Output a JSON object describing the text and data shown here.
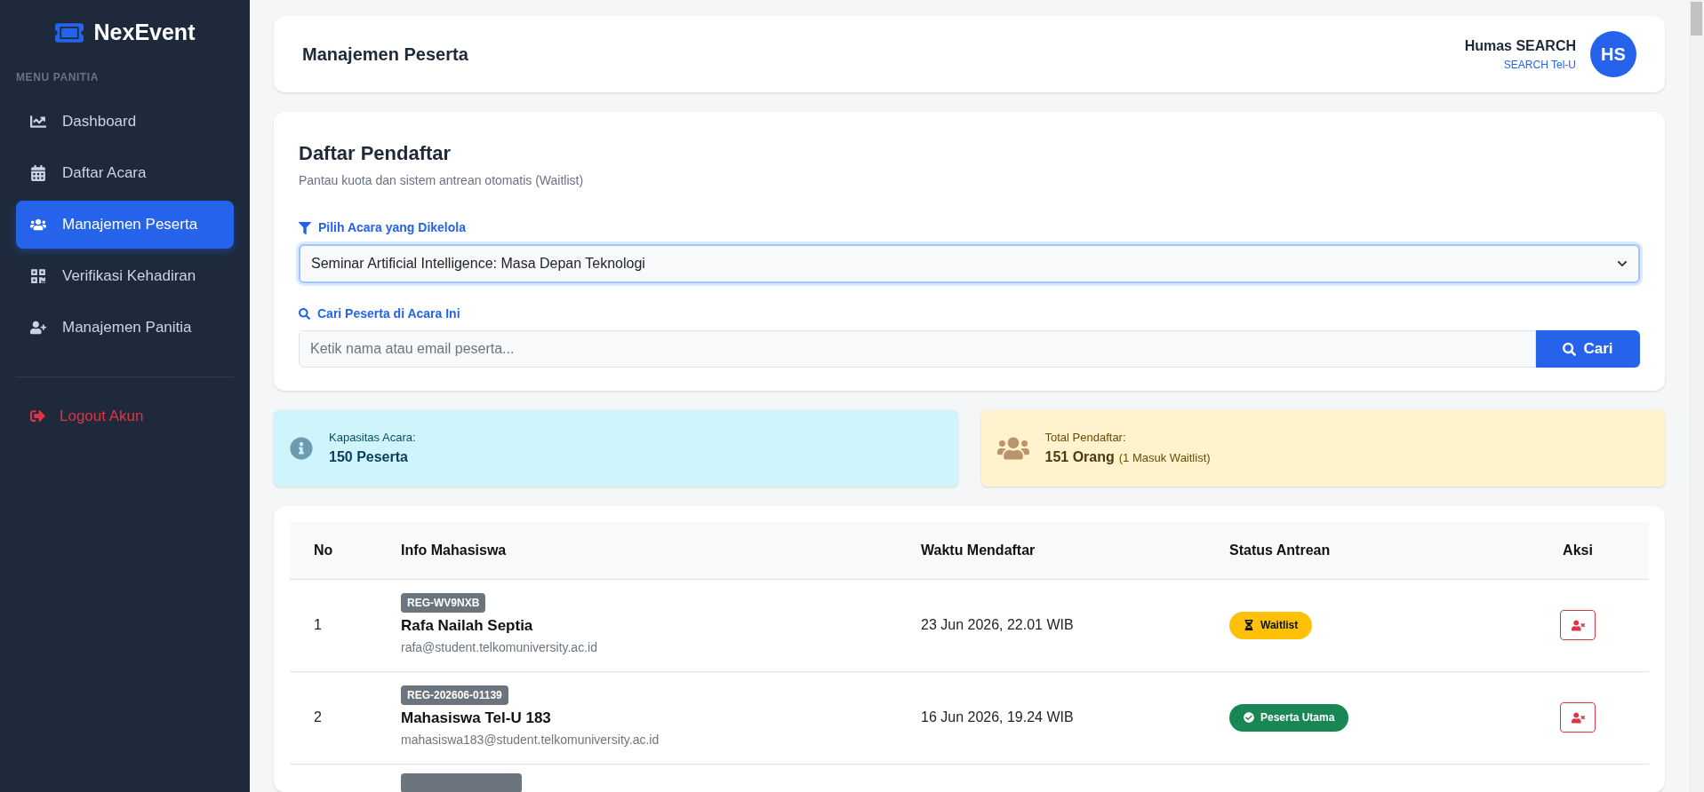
{
  "sidebar": {
    "brand": "NexEvent",
    "section_label": "MENU PANITIA",
    "items": [
      {
        "label": "Dashboard",
        "selected": false
      },
      {
        "label": "Daftar Acara",
        "selected": false
      },
      {
        "label": "Manajemen Peserta",
        "selected": true
      },
      {
        "label": "Verifikasi Kehadiran",
        "selected": false
      },
      {
        "label": "Manajemen Panitia",
        "selected": false
      }
    ],
    "logout": "Logout Akun"
  },
  "header": {
    "title": "Manajemen Peserta",
    "user_name": "Humas SEARCH",
    "user_org": "SEARCH Tel-U",
    "avatar_initials": "HS"
  },
  "registrants_panel": {
    "title": "Daftar Pendaftar",
    "subtitle": "Pantau kuota dan sistem antrean otomatis (Waitlist)",
    "event_label": "Pilih Acara yang Dikelola",
    "event_value": "Seminar Artificial Intelligence: Masa Depan Teknologi",
    "search_label": "Cari Peserta di Acara Ini",
    "search_placeholder": "Ketik nama atau email peserta...",
    "search_button": "Cari"
  },
  "stats": [
    {
      "kind": "capacity",
      "label": "Kapasitas Acara:",
      "value": "150 Peserta"
    },
    {
      "kind": "total",
      "label": "Total Pendaftar:",
      "value": "151 Orang",
      "note": "(1 Masuk Waitlist)"
    }
  ],
  "table": {
    "columns": [
      "No",
      "Info Mahasiswa",
      "Waktu Mendaftar",
      "Status Antrean",
      "Aksi"
    ],
    "rows": [
      {
        "no": "1",
        "reg_id": "REG-WV9NXB",
        "name": "Rafa Nailah Septia",
        "email": "rafa@student.telkomuniversity.ac.id",
        "registered_at": "23 Jun 2026, 22.01 WIB",
        "status": {
          "kind": "waitlist",
          "label": "Waitlist"
        }
      },
      {
        "no": "2",
        "reg_id": "REG-202606-01139",
        "name": "Mahasiswa Tel-U 183",
        "email": "mahasiswa183@student.telkomuniversity.ac.id",
        "registered_at": "16 Jun 2026, 19.24 WIB",
        "status": {
          "kind": "main",
          "label": "Peserta Utama"
        }
      }
    ]
  }
}
